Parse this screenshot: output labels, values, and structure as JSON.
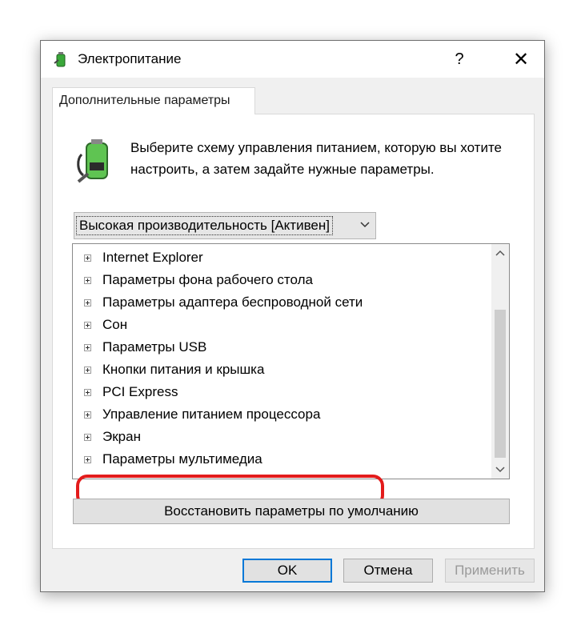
{
  "window": {
    "title": "Электропитание",
    "help_label": "?",
    "close_label": "✕"
  },
  "tab": {
    "label": "Дополнительные параметры"
  },
  "description": "Выберите схему управления питанием, которую вы хотите настроить, а затем задайте нужные параметры.",
  "scheme_select": {
    "value": "Высокая производительность [Активен]"
  },
  "tree": {
    "items": [
      "Internet Explorer",
      "Параметры фона рабочего стола",
      "Параметры адаптера беспроводной сети",
      "Сон",
      "Параметры USB",
      "Кнопки питания и крышка",
      "PCI Express",
      "Управление питанием процессора",
      "Экран",
      "Параметры мультимедиа"
    ],
    "highlighted_item": "Управление питанием процессора"
  },
  "restore_button": {
    "label": "Восстановить параметры по умолчанию"
  },
  "buttons": {
    "ok": "OK",
    "cancel": "Отмена",
    "apply": "Применить"
  },
  "colors": {
    "highlight": "#e31b1b",
    "focus_border": "#0078d7"
  }
}
